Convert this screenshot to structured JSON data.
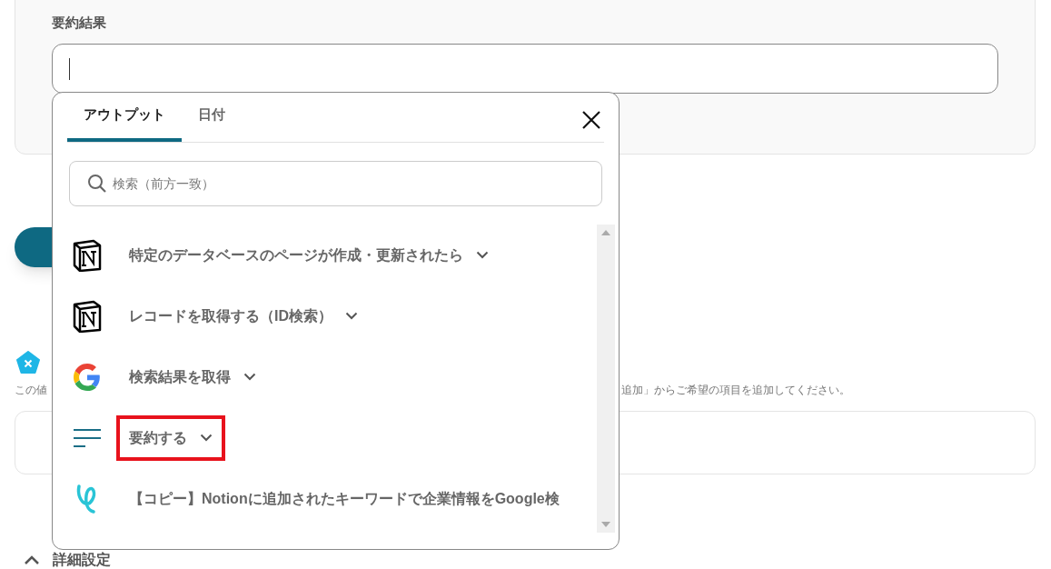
{
  "result_field": {
    "label": "要約結果"
  },
  "helper_text": {
    "left": "この値",
    "right": "追加」からご希望の項目を追加してください。"
  },
  "advanced": {
    "label": "詳細設定"
  },
  "popup": {
    "tabs": [
      {
        "label": "アウトプット",
        "selected": true
      },
      {
        "label": "日付",
        "selected": false
      }
    ],
    "search": {
      "placeholder": "検索（前方一致）"
    },
    "items": [
      {
        "kind": "notion",
        "label": "特定のデータベースのページが作成・更新されたら",
        "expandable": true,
        "highlighted": false
      },
      {
        "kind": "notion",
        "label": "レコードを取得する（ID検索）",
        "expandable": true,
        "highlighted": false
      },
      {
        "kind": "google",
        "label": "検索結果を取得",
        "expandable": true,
        "highlighted": false
      },
      {
        "kind": "summary",
        "label": "要約する",
        "expandable": true,
        "highlighted": true
      },
      {
        "kind": "yoom",
        "label": "【コピー】Notionに追加されたキーワードで企業情報をGoogle検",
        "expandable": false,
        "highlighted": false
      }
    ]
  }
}
